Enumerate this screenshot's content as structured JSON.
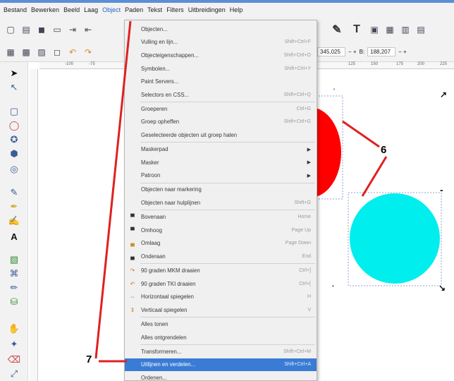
{
  "menubar": {
    "items": [
      "Bestand",
      "Bewerken",
      "Beeld",
      "Laag",
      "Object",
      "Paden",
      "Tekst",
      "Filters",
      "Uitbreidingen",
      "Help"
    ],
    "active_index": 4
  },
  "coords": {
    "x_value": "345,025",
    "x_plus_minus": "− +",
    "b_label": "B:",
    "b_value": "188,207",
    "b_plus_minus": "− +"
  },
  "ruler_ticks": [
    "-100",
    "-75",
    "125",
    "150",
    "175",
    "200",
    "225"
  ],
  "object_menu": {
    "items": [
      {
        "label": "Objecten...",
        "shortcut": "",
        "icon": ""
      },
      {
        "label": "Vulling en lijn...",
        "shortcut": "Shift+Ctrl+F",
        "icon": ""
      },
      {
        "label": "Objecteigenschappen...",
        "shortcut": "Shift+Ctrl+O",
        "icon": ""
      },
      {
        "label": "Symbolen...",
        "shortcut": "Shift+Ctrl+Y",
        "icon": ""
      },
      {
        "label": "Paint Servers...",
        "shortcut": "",
        "icon": ""
      },
      {
        "label": "Selectors en CSS...",
        "shortcut": "Shift+Ctrl+Q",
        "icon": ""
      },
      {
        "label": "Groeperen",
        "shortcut": "Ctrl+G",
        "icon": ""
      },
      {
        "label": "Groep opheffen",
        "shortcut": "Shift+Ctrl+G",
        "icon": ""
      },
      {
        "label": "Geselecteerde objecten uit groep halen",
        "shortcut": "",
        "icon": ""
      },
      {
        "label": "Maskerpad",
        "shortcut": "",
        "icon": "",
        "submenu": true
      },
      {
        "label": "Masker",
        "shortcut": "",
        "icon": "",
        "submenu": true
      },
      {
        "label": "Patroon",
        "shortcut": "",
        "icon": "",
        "submenu": true
      },
      {
        "label": "Objecten naar markering",
        "shortcut": "",
        "icon": ""
      },
      {
        "label": "Objecten naar hulplijnen",
        "shortcut": "Shift+G",
        "icon": ""
      },
      {
        "label": "Bovenaan",
        "shortcut": "Home",
        "icon": "raise-to-top-icon"
      },
      {
        "label": "Omhoog",
        "shortcut": "Page Up",
        "icon": "raise-icon"
      },
      {
        "label": "Omlaag",
        "shortcut": "Page Down",
        "icon": "lower-icon"
      },
      {
        "label": "Onderaan",
        "shortcut": "End",
        "icon": "lower-to-bottom-icon"
      },
      {
        "label": "90 graden MKM draaien",
        "shortcut": "Ctrl+]",
        "icon": "rotate-cw-icon"
      },
      {
        "label": "90 graden TKI draaien",
        "shortcut": "Ctrl+[",
        "icon": "rotate-ccw-icon"
      },
      {
        "label": "Horizontaal spiegelen",
        "shortcut": "H",
        "icon": "flip-horizontal-icon"
      },
      {
        "label": "Verticaal spiegelen",
        "shortcut": "V",
        "icon": "flip-vertical-icon"
      },
      {
        "label": "Alles tonen",
        "shortcut": "",
        "icon": ""
      },
      {
        "label": "Alles ontgrendelen",
        "shortcut": "",
        "icon": ""
      },
      {
        "label": "Transformeren...",
        "shortcut": "Shift+Ctrl+M",
        "icon": ""
      },
      {
        "label": "Uitlijnen en verdelen...",
        "shortcut": "Shift+Ctrl+A",
        "icon": "",
        "highlighted": true
      },
      {
        "label": "Ordenen...",
        "shortcut": "",
        "icon": ""
      }
    ]
  },
  "annotations": {
    "label_six": "6",
    "label_seven": "7"
  },
  "colors": {
    "red_shape": "#ff0000",
    "cyan_circle": "#00eeee",
    "annotation_line": "#e02020",
    "highlight": "#3a7bd5"
  }
}
